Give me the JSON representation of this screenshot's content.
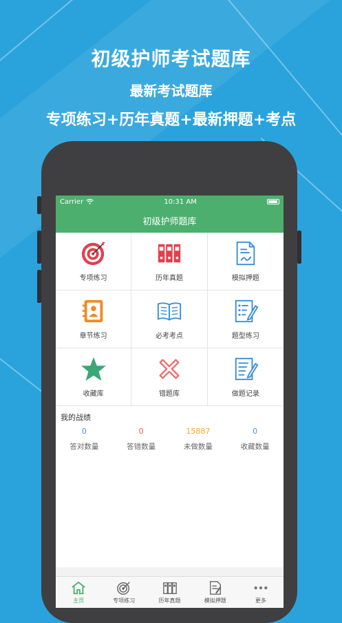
{
  "promo": {
    "title": "初级护师考试题库",
    "subtitle": "最新考试题库",
    "features": "专项练习+历年真题+最新押题+考点"
  },
  "status": {
    "carrier": "Carrier",
    "time": "10:31 AM"
  },
  "nav": {
    "title": "初级护师题库"
  },
  "menu": [
    {
      "label": "专项练习",
      "icon": "target-icon"
    },
    {
      "label": "历年真题",
      "icon": "binders-icon"
    },
    {
      "label": "模拟押题",
      "icon": "document-edit-icon"
    },
    {
      "label": "章节练习",
      "icon": "contacts-book-icon"
    },
    {
      "label": "必考考点",
      "icon": "open-book-icon"
    },
    {
      "label": "题型练习",
      "icon": "checklist-icon"
    },
    {
      "label": "收藏库",
      "icon": "star-icon"
    },
    {
      "label": "错题库",
      "icon": "cross-icon"
    },
    {
      "label": "做题记录",
      "icon": "record-icon"
    }
  ],
  "stats": {
    "title": "我的战绩",
    "items": [
      {
        "value": "0",
        "label": "答对数量",
        "color": "#4a90e2"
      },
      {
        "value": "0",
        "label": "答错数量",
        "color": "#e05a4f"
      },
      {
        "value": "15887",
        "label": "未做数量",
        "color": "#f0a830"
      },
      {
        "value": "0",
        "label": "收藏数量",
        "color": "#4a90e2"
      }
    ]
  },
  "tabs": [
    {
      "label": "主页",
      "icon": "home-icon",
      "active": true
    },
    {
      "label": "专项练习",
      "icon": "target-icon",
      "active": false
    },
    {
      "label": "历年真题",
      "icon": "binders-icon",
      "active": false
    },
    {
      "label": "模拟押题",
      "icon": "document-edit-icon",
      "active": false
    },
    {
      "label": "更多",
      "icon": "more-dots-icon",
      "active": false
    }
  ],
  "colors": {
    "background": "#2aa3dc",
    "accent": "#4caf6e",
    "phone_body": "#3f3f41"
  }
}
